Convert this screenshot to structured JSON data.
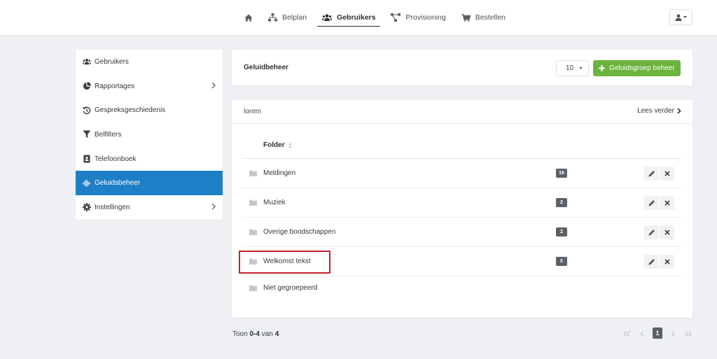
{
  "nav": {
    "items": [
      {
        "label": "",
        "icon": "home-icon"
      },
      {
        "label": "Belplan",
        "icon": "sitemap-icon"
      },
      {
        "label": "Gebruikers",
        "icon": "users-icon",
        "active": true
      },
      {
        "label": "Provisioning",
        "icon": "network-icon"
      },
      {
        "label": "Bestellen",
        "icon": "cart-icon"
      }
    ],
    "user_menu_icon": "user-icon"
  },
  "sidebar": {
    "items": [
      {
        "label": "Gebruikers",
        "icon": "users-icon"
      },
      {
        "label": "Rapportages",
        "icon": "pie-chart-icon",
        "has_submenu": true
      },
      {
        "label": "Gespreksgeschiedenis",
        "icon": "history-icon"
      },
      {
        "label": "Belfilters",
        "icon": "filter-icon"
      },
      {
        "label": "Telefoonboek",
        "icon": "address-book-icon"
      },
      {
        "label": "Geluidsbeheer",
        "icon": "soundwave-icon",
        "active": true
      },
      {
        "label": "Instellingen",
        "icon": "gear-icon",
        "has_submenu": true
      }
    ]
  },
  "header": {
    "title": "Geluidbeheer",
    "page_size": "10",
    "add_button": "Geluidsgroep beheer"
  },
  "intro": {
    "text": "lorem",
    "read_more": "Lees verder"
  },
  "table": {
    "column_folder": "Folder",
    "rows": [
      {
        "name": "Meldingen",
        "count": "16",
        "actions": true
      },
      {
        "name": "Muziek",
        "count": "2",
        "actions": true
      },
      {
        "name": "Overige boodschappen",
        "count": "2",
        "actions": true
      },
      {
        "name": "Welkomst tekst",
        "count": "0",
        "actions": true,
        "highlighted": true
      },
      {
        "name": "Niet gegroepeerd",
        "count": "",
        "actions": false
      }
    ]
  },
  "footer": {
    "prefix": "Toon",
    "range": "0-4",
    "middle": "van",
    "total": "4",
    "current_page": "1"
  },
  "colors": {
    "active_blue": "#1e7fc6",
    "add_green": "#6cb33f",
    "badge_gray": "#5b6167",
    "highlight_red": "#c8202f"
  }
}
